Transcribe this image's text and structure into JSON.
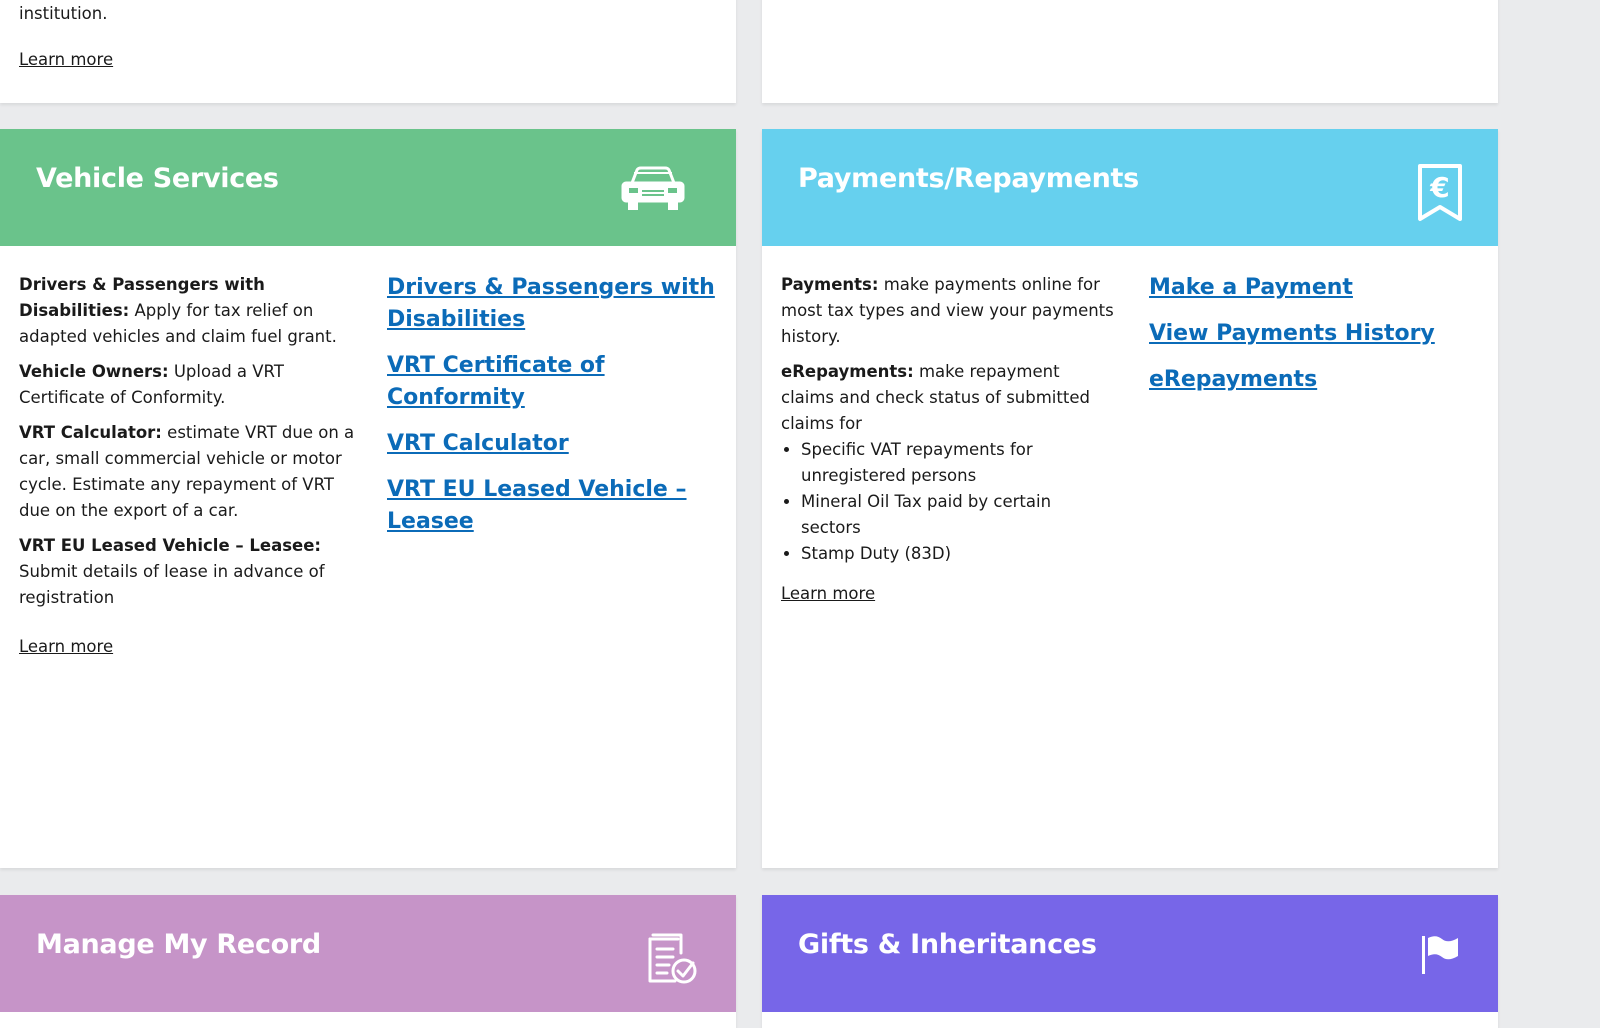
{
  "top_left": {
    "trailing_text": "institution.",
    "learn_more": "Learn more"
  },
  "vehicle": {
    "title": "Vehicle Services",
    "header_color": "#6ac38b",
    "icon": "car-icon",
    "items": [
      {
        "label": "Drivers & Passengers with Disabilities:",
        "text": " Apply for tax relief on adapted vehicles and claim fuel grant."
      },
      {
        "label": "Vehicle Owners:",
        "text": " Upload a VRT Certificate of Conformity."
      },
      {
        "label": "VRT Calculator:",
        "text": " estimate VRT due on a car, small commercial vehicle or motor cycle. Estimate any repayment of VRT due on the export of a car."
      },
      {
        "label": "VRT EU Leased Vehicle – Leasee:",
        "text": " Submit details of lease in advance of registration"
      }
    ],
    "learn_more": "Learn more",
    "links": [
      "Drivers & Passengers with Disabilities",
      "VRT Certificate of Conformity",
      "VRT Calculator",
      "VRT EU Leased Vehicle – Leasee"
    ]
  },
  "payments": {
    "title": "Payments/Repayments",
    "header_color": "#66d0ee",
    "icon": "euro-receipt-icon",
    "items": [
      {
        "label": "Payments:",
        "text": " make payments online for most tax types and view your payments history."
      },
      {
        "label": "eRepayments:",
        "text": " make repayment claims and check status of submitted claims for"
      }
    ],
    "bullets": [
      "Specific VAT repayments for unregistered persons",
      "Mineral Oil Tax paid by certain sectors",
      "Stamp Duty (83D)"
    ],
    "learn_more": "Learn more",
    "links": [
      "Make a Payment",
      "View Payments History",
      "eRepayments"
    ]
  },
  "record": {
    "title": "Manage My Record",
    "header_color": "#c694c8",
    "icon": "document-check-icon"
  },
  "gifts": {
    "title": "Gifts & Inheritances",
    "header_color": "#7766e8",
    "icon": "flag-icon"
  },
  "colors": {
    "background": "#eaebed",
    "link": "#0b6bb8"
  }
}
